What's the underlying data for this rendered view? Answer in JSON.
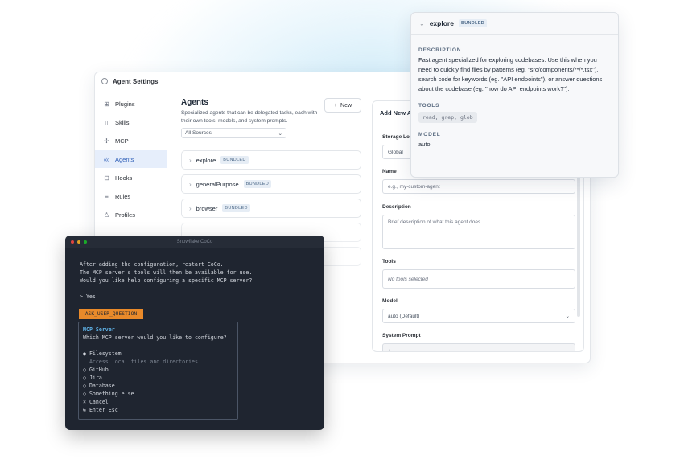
{
  "settings": {
    "title": "Agent Settings",
    "sidebar": [
      {
        "label": "Plugins",
        "icon": "plugins-icon",
        "glyph": "⊞",
        "active": false
      },
      {
        "label": "Skills",
        "icon": "skills-icon",
        "glyph": "▯",
        "active": false
      },
      {
        "label": "MCP",
        "icon": "mcp-icon",
        "glyph": "✢",
        "active": false
      },
      {
        "label": "Agents",
        "icon": "agents-icon",
        "glyph": "◎",
        "active": true
      },
      {
        "label": "Hooks",
        "icon": "hooks-icon",
        "glyph": "⊡",
        "active": false
      },
      {
        "label": "Rules",
        "icon": "rules-icon",
        "glyph": "≡",
        "active": false
      },
      {
        "label": "Profiles",
        "icon": "profiles-icon",
        "glyph": "♙",
        "active": false
      }
    ],
    "agents": {
      "title": "Agents",
      "description": "Specialized agents that can be delegated tasks, each with their own tools, models, and system prompts.",
      "new_label": "New",
      "source_filter": "All Sources",
      "items": [
        {
          "name": "explore",
          "badge": "BUNDLED"
        },
        {
          "name": "generalPurpose",
          "badge": "BUNDLED"
        },
        {
          "name": "browser",
          "badge": "BUNDLED"
        }
      ]
    },
    "add_panel": {
      "title": "Add New A",
      "storage_label": "Storage Loc",
      "storage_value": "Global",
      "name_label": "Name",
      "name_placeholder": "e.g., my-custom-agent",
      "description_label": "Description",
      "description_placeholder": "Brief description of what this agent does",
      "tools_label": "Tools",
      "tools_value": "No tools selected",
      "model_label": "Model",
      "model_value": "auto (Default)",
      "system_prompt_label": "System Prompt",
      "system_prompt_line": "1"
    }
  },
  "popover": {
    "title": "explore",
    "badge": "BUNDLED",
    "description_label": "DESCRIPTION",
    "description": "Fast agent specialized for exploring codebases. Use this when you need to quickly find files by patterns (eg. \"src/components/**/*.tsx\"), search code for keywords (eg. \"API endpoints\"), or answer questions about the codebase (eg. \"how do API endpoints work?\").",
    "tools_label": "TOOLS",
    "tools": "read, grep, glob",
    "model_label": "MODEL",
    "model": "auto"
  },
  "terminal": {
    "title": "Snowflake CoCo",
    "line1": "After adding the configuration, restart CoCo.",
    "line2": "The MCP server's tools will then be available for use.",
    "line3": "Would you like help configuring a specific MCP server?",
    "answer": "> Yes",
    "tag": "ASK_USER_QUESTION",
    "question_title": "MCP Server",
    "question": "Which MCP server would you like to configure?",
    "options": [
      {
        "label": "● Filesystem"
      },
      {
        "label": "  Access local files and directories"
      },
      {
        "label": "○ GitHub"
      },
      {
        "label": "○ Jira"
      },
      {
        "label": "○ Database"
      },
      {
        "label": "○ Something else"
      },
      {
        "label": "× Cancel"
      },
      {
        "label": "⇆ Enter Esc"
      }
    ]
  },
  "colors": {
    "accent": "#2f5fb8",
    "terminal_bg": "#1f2530",
    "tag_orange": "#e98a2a",
    "question_blue": "#5fb3e8"
  }
}
